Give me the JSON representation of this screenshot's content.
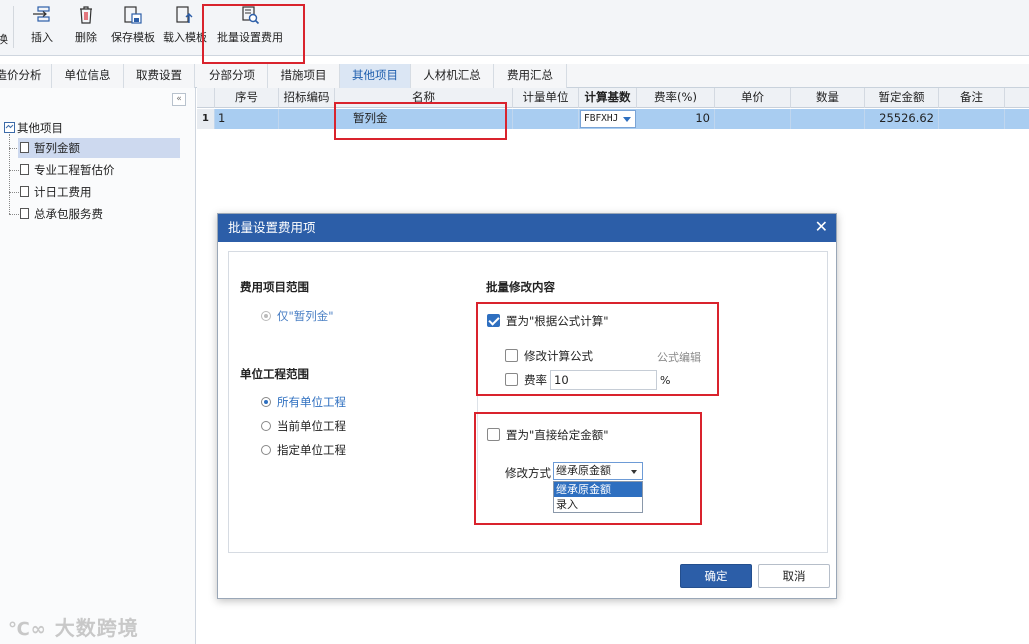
{
  "toolbar": {
    "partial_label": "换",
    "insert": "插入",
    "delete": "删除",
    "save_template": "保存模板",
    "load_template": "载入模板",
    "batch_fee": "批量设置费用"
  },
  "tabs": [
    "造价分析",
    "单位信息",
    "取费设置",
    "分部分项",
    "措施项目",
    "其他项目",
    "人材机汇总",
    "费用汇总"
  ],
  "tree": {
    "root": "其他项目",
    "items": [
      "暂列金额",
      "专业工程暂估价",
      "计日工费用",
      "总承包服务费"
    ]
  },
  "grid": {
    "columns": [
      "序号",
      "招标编码",
      "名称",
      "计量单位",
      "计算基数",
      "费率(%)",
      "单价",
      "数量",
      "暂定金额",
      "备注"
    ],
    "row": {
      "row_num": "1",
      "seq": "1",
      "code": "",
      "name": "暂列金",
      "unit": "",
      "base": "FBFXHJ",
      "rate": "10",
      "price": "",
      "qty": "",
      "amount": "25526.62",
      "remark": ""
    }
  },
  "dialog": {
    "title": "批量设置费用项",
    "scope_title": "费用项目范围",
    "scope_option": "仅\"暂列金\"",
    "unit_title": "单位工程范围",
    "unit_options": [
      "所有单位工程",
      "当前单位工程",
      "指定单位工程"
    ],
    "modify_title": "批量修改内容",
    "formula_calc": "置为\"根据公式计算\"",
    "modify_formula": "修改计算公式",
    "formula_edit": "公式编辑",
    "rate_label": "费率",
    "rate_value": "10",
    "percent": "%",
    "direct_amount": "置为\"直接给定金额\"",
    "modify_mode_label": "修改方式",
    "modify_mode_value": "继承原金额",
    "mode_options": [
      "继承原金额",
      "录入"
    ],
    "ok": "确定",
    "cancel": "取消"
  },
  "watermark": "大数跨境",
  "colors": {
    "accent": "#2c5ea8",
    "highlight_box": "#d9232d",
    "selected_row": "#a9cdf1"
  }
}
